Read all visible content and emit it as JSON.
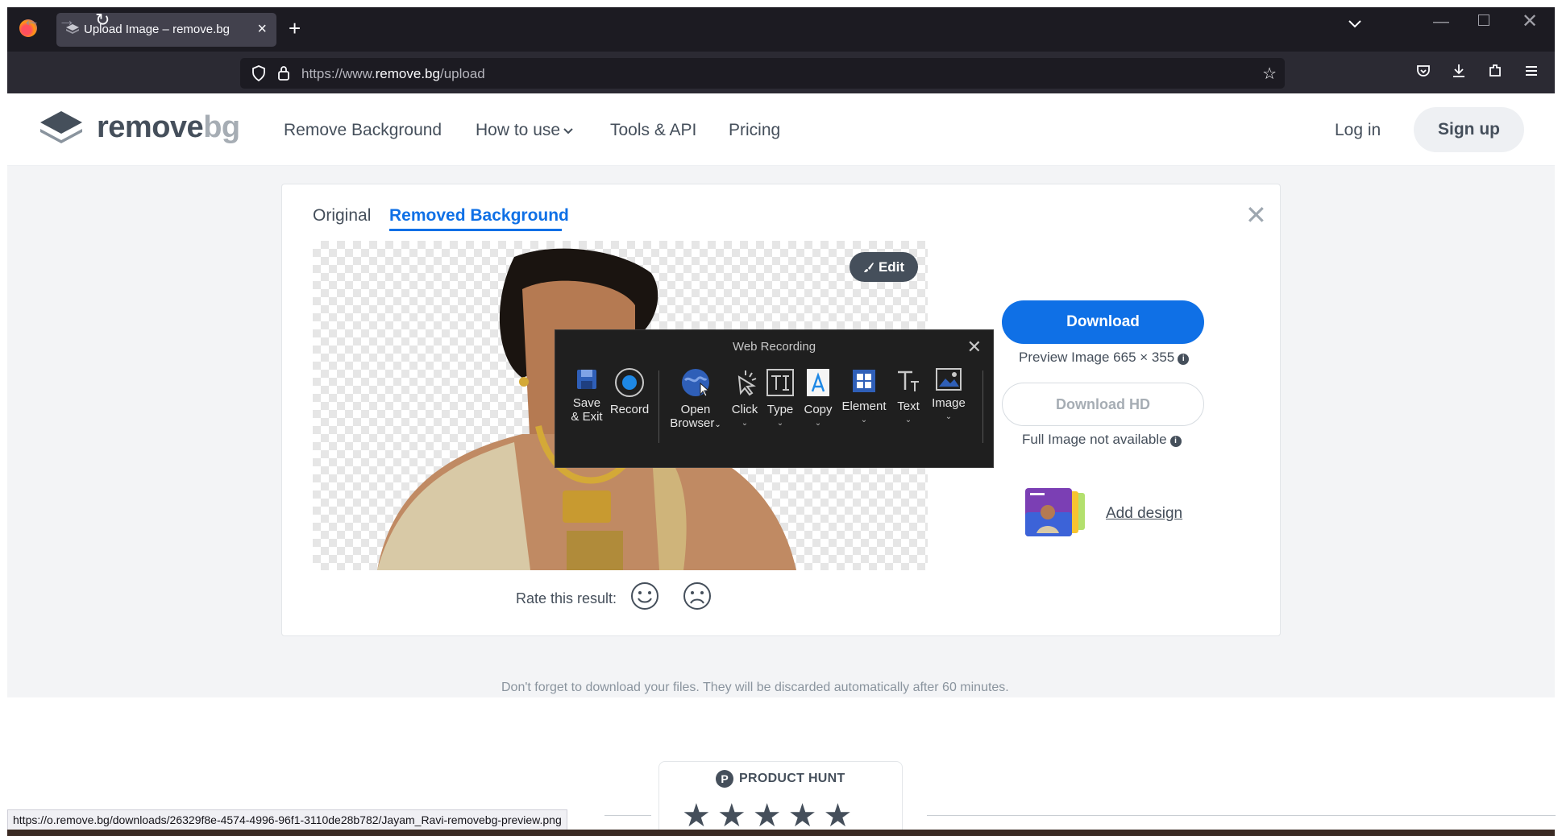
{
  "browser": {
    "tab_title": "Upload Image – remove.bg",
    "url_prefix": "https://www.",
    "url_domain": "remove.bg",
    "url_path": "/upload",
    "status_url": "https://o.remove.bg/downloads/26329f8e-4574-4996-96f1-3110de28b782/Jayam_Ravi-removebg-preview.png"
  },
  "site": {
    "logo_main": "remove",
    "logo_bg": "bg",
    "nav": [
      "Remove Background",
      "How to use",
      "Tools & API",
      "Pricing"
    ],
    "login": "Log in",
    "signup": "Sign up"
  },
  "editor": {
    "tab_original": "Original",
    "tab_removed": "Removed Background",
    "edit_label": "Edit",
    "rate_label": "Rate this result:",
    "download_label": "Download",
    "preview_info": "Preview Image 665 × 355",
    "download_hd_label": "Download HD",
    "full_info": "Full Image not available",
    "add_design": "Add design"
  },
  "notice": "Don't forget to download your files. They will be discarded automatically after 60 minutes.",
  "recorder": {
    "title": "Web Recording",
    "items": [
      {
        "label1": "Save",
        "label2": "& Exit"
      },
      {
        "label1": "Record",
        "label2": ""
      },
      {
        "label1": "Open",
        "label2": "Browser"
      },
      {
        "label1": "Click",
        "label2": ""
      },
      {
        "label1": "Type",
        "label2": ""
      },
      {
        "label1": "Copy",
        "label2": ""
      },
      {
        "label1": "Element",
        "label2": ""
      },
      {
        "label1": "Text",
        "label2": ""
      },
      {
        "label1": "Image",
        "label2": ""
      }
    ]
  },
  "product_hunt": {
    "label": "PRODUCT HUNT",
    "stars": "★★★★★",
    "logo_letter": "P"
  },
  "colors": {
    "accent": "#0f70e6",
    "text": "#454f5b",
    "chrome_dark": "#1c1b22"
  }
}
